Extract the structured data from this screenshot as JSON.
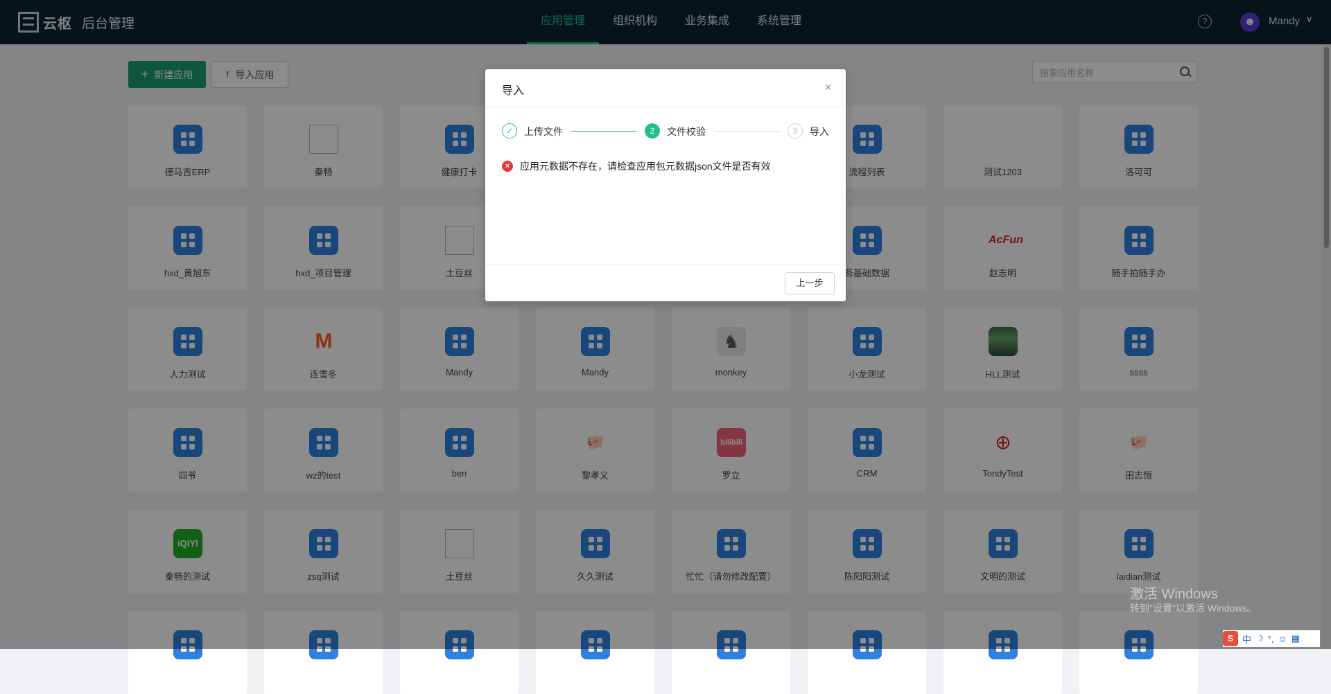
{
  "header": {
    "logo_text": "云枢",
    "app_title": "后台管理",
    "nav": [
      {
        "label": "应用管理",
        "active": true
      },
      {
        "label": "组织机构",
        "active": false
      },
      {
        "label": "业务集成",
        "active": false
      },
      {
        "label": "系统管理",
        "active": false
      }
    ],
    "help_glyph": "?",
    "user": {
      "avatar_glyph": "☻",
      "name": "Mandy",
      "chevron": "∨"
    }
  },
  "toolbar": {
    "new_app_label": "新建应用",
    "import_app_label": "导入应用",
    "search_placeholder": "搜索应用名称"
  },
  "apps": [
    {
      "label": "德马吉ERP",
      "icon": "grid-icon"
    },
    {
      "label": "秦畅",
      "icon": "broken-image-icon"
    },
    {
      "label": "健康打卡",
      "icon": "grid-icon"
    },
    {
      "label": "",
      "icon": "grid-icon"
    },
    {
      "label": "",
      "icon": "grid-icon"
    },
    {
      "label": "流程列表",
      "icon": "grid-icon"
    },
    {
      "label": "测试1203",
      "icon": "cabbage-icon"
    },
    {
      "label": "洛可可",
      "icon": "grid-icon"
    },
    {
      "label": "hxd_黄旭东",
      "icon": "grid-icon"
    },
    {
      "label": "hxd_项目管理",
      "icon": "grid-icon"
    },
    {
      "label": "土豆丝",
      "icon": "broken-image-icon"
    },
    {
      "label": "",
      "icon": "grid-icon"
    },
    {
      "label": "",
      "icon": "grid-icon"
    },
    {
      "label": "务基础数据",
      "icon": "grid-icon"
    },
    {
      "label": "赵志明",
      "icon": "acfun-icon",
      "glyph": "AcFun"
    },
    {
      "label": "随手拍随手办",
      "icon": "grid-icon"
    },
    {
      "label": "人力测试",
      "icon": "grid-icon"
    },
    {
      "label": "连雪冬",
      "icon": "mango-icon",
      "glyph": "M"
    },
    {
      "label": "Mandy",
      "icon": "grid-icon"
    },
    {
      "label": "Mandy",
      "icon": "grid-icon"
    },
    {
      "label": "monkey",
      "icon": "monkey-icon",
      "glyph": "♞"
    },
    {
      "label": "小龙测试",
      "icon": "grid-icon"
    },
    {
      "label": "HLL测试",
      "icon": "photo-icon"
    },
    {
      "label": "ssss",
      "icon": "grid-icon"
    },
    {
      "label": "四爷",
      "icon": "grid-icon"
    },
    {
      "label": "wz的test",
      "icon": "grid-icon"
    },
    {
      "label": "ben",
      "icon": "grid-icon"
    },
    {
      "label": "黎孝义",
      "icon": "pig-icon",
      "glyph": "🐖"
    },
    {
      "label": "罗立",
      "icon": "bilibili-icon",
      "glyph": "bilibili"
    },
    {
      "label": "CRM",
      "icon": "grid-icon"
    },
    {
      "label": "TondyTest",
      "icon": "railway-icon",
      "glyph": "⊕"
    },
    {
      "label": "田志恒",
      "icon": "pig-icon",
      "glyph": "🐖"
    },
    {
      "label": "秦畅的测试",
      "icon": "iqiyi-icon",
      "glyph": "iQIYI"
    },
    {
      "label": "zsq测试",
      "icon": "grid-icon"
    },
    {
      "label": "土豆丝",
      "icon": "broken-image-icon"
    },
    {
      "label": "久久测试",
      "icon": "grid-icon"
    },
    {
      "label": "忙忙（请勿修改配置）",
      "icon": "grid-icon"
    },
    {
      "label": "陈阳阳测试",
      "icon": "grid-icon"
    },
    {
      "label": "文明的测试",
      "icon": "grid-icon"
    },
    {
      "label": "laidian测试",
      "icon": "grid-icon"
    },
    {
      "label": "",
      "icon": "grid-icon"
    },
    {
      "label": "",
      "icon": "grid-icon"
    },
    {
      "label": "",
      "icon": "grid-icon"
    },
    {
      "label": "",
      "icon": "grid-icon"
    },
    {
      "label": "",
      "icon": "grid-icon"
    },
    {
      "label": "",
      "icon": "grid-icon"
    },
    {
      "label": "",
      "icon": "grid-icon"
    },
    {
      "label": "",
      "icon": "grid-icon"
    }
  ],
  "modal": {
    "title": "导入",
    "close_glyph": "×",
    "steps": [
      {
        "index": "✓",
        "label": "上传文件",
        "status": "done"
      },
      {
        "index": "2",
        "label": "文件校验",
        "status": "active"
      },
      {
        "index": "3",
        "label": "导入",
        "status": "wait"
      }
    ],
    "error_glyph": "×",
    "error_text": "应用元数据不存在，请检查应用包元数据json文件是否有效",
    "prev_button": "上一步"
  },
  "watermark": {
    "line1": "激活 Windows",
    "line2": "转到\"设置\"以激活 Windows。"
  },
  "ime": {
    "logo": "S",
    "items": [
      "中",
      "☽",
      "°,",
      "☺",
      "▦"
    ]
  },
  "colors": {
    "topbar": "#0c2631",
    "accent": "#1fbf8f",
    "primary_button": "#1d9c74",
    "app_icon_blue": "#2f80e0",
    "error": "#e8363a"
  }
}
